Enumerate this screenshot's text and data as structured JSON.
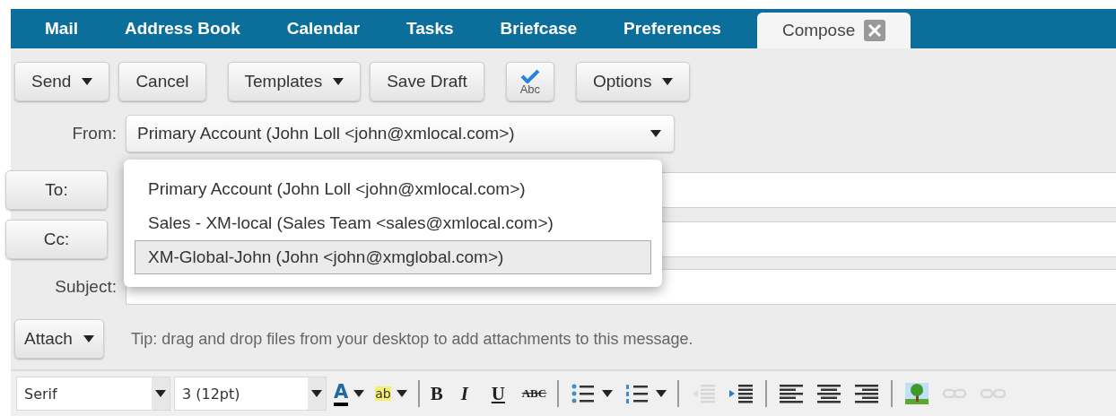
{
  "tabs": [
    {
      "label": "Mail",
      "selected": false
    },
    {
      "label": "Address Book",
      "selected": false
    },
    {
      "label": "Calendar",
      "selected": false
    },
    {
      "label": "Tasks",
      "selected": false
    },
    {
      "label": "Briefcase",
      "selected": false
    },
    {
      "label": "Preferences",
      "selected": false
    },
    {
      "label": "Compose",
      "selected": true,
      "closable": true
    }
  ],
  "toolbar": [
    {
      "kind": "menu",
      "label": "Send"
    },
    {
      "kind": "button",
      "label": "Cancel"
    },
    {
      "kind": "gap"
    },
    {
      "kind": "menu",
      "label": "Templates"
    },
    {
      "kind": "button",
      "label": "Save Draft"
    },
    {
      "kind": "gap"
    },
    {
      "kind": "spellcheck",
      "label": "Abc"
    },
    {
      "kind": "gap"
    },
    {
      "kind": "menu",
      "label": "Options"
    }
  ],
  "from": {
    "label": "From:",
    "value": "Primary Account (John Loll <john@xmlocal.com>)",
    "expanded": true,
    "options": [
      {
        "label": "Primary Account (John Loll <john@xmlocal.com>)",
        "highlighted": false
      },
      {
        "label": "Sales - XM-local (Sales Team <sales@xmlocal.com>)",
        "highlighted": false
      },
      {
        "label": "XM-Global-John (John <john@xmglobal.com>)",
        "highlighted": true
      }
    ]
  },
  "recipients": [
    {
      "label": "To:"
    },
    {
      "label": "Cc:"
    }
  ],
  "subject": {
    "label": "Subject:"
  },
  "attach": {
    "label": "Attach",
    "tip": "Tip: drag and drop files from your desktop to add attachments to this message."
  },
  "format": {
    "font": "Serif",
    "size": "3 (12pt)",
    "tools": [
      {
        "kind": "color",
        "label": "A",
        "dropdown": true,
        "disabled": false
      },
      {
        "kind": "highlight",
        "label": "ab",
        "dropdown": true,
        "disabled": false
      },
      {
        "kind": "separator"
      },
      {
        "kind": "bold",
        "label": "B",
        "disabled": false
      },
      {
        "kind": "italic",
        "label": "I",
        "disabled": false
      },
      {
        "kind": "underline",
        "label": "U",
        "disabled": false
      },
      {
        "kind": "strike",
        "label": "ABC",
        "disabled": false
      },
      {
        "kind": "separator"
      },
      {
        "kind": "bullets",
        "dropdown": true,
        "disabled": false
      },
      {
        "kind": "numbers",
        "dropdown": true,
        "disabled": false
      },
      {
        "kind": "separator"
      },
      {
        "kind": "outdent",
        "disabled": true
      },
      {
        "kind": "indent",
        "disabled": false
      },
      {
        "kind": "separator"
      },
      {
        "kind": "align-left",
        "disabled": false
      },
      {
        "kind": "align-center",
        "disabled": false
      },
      {
        "kind": "align-right",
        "disabled": false
      },
      {
        "kind": "separator"
      },
      {
        "kind": "image",
        "disabled": false
      },
      {
        "kind": "link",
        "disabled": true
      },
      {
        "kind": "unlink",
        "disabled": true
      }
    ]
  }
}
